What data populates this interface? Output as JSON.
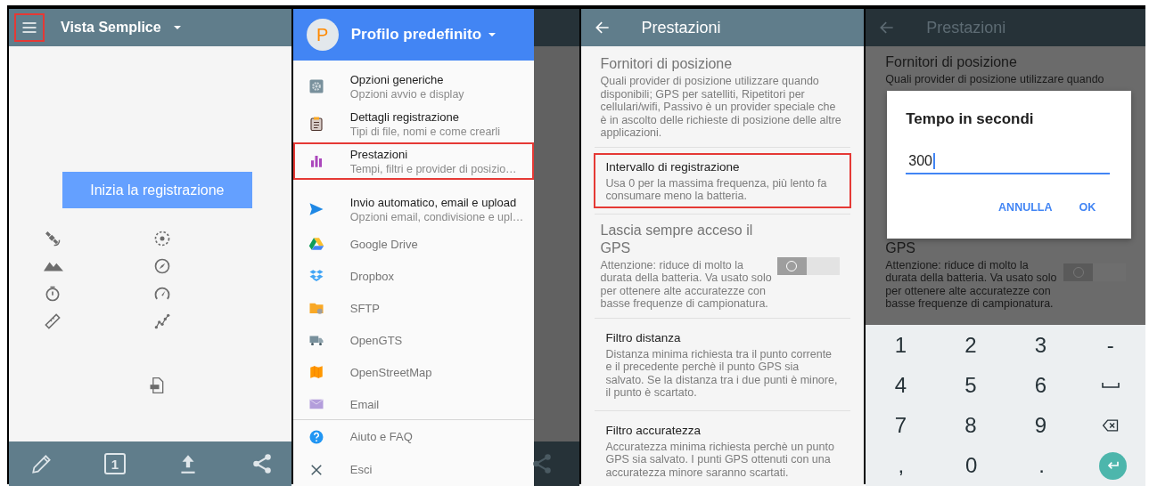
{
  "main_screen": {
    "title": "Vista Semplice",
    "menu_highlighted": true,
    "start_button": "Inizia la registrazione",
    "counter": "1"
  },
  "drawer": {
    "avatar_letter": "P",
    "profile": "Profilo predefinito",
    "items": [
      {
        "kind": "main",
        "title": "Opzioni generiche",
        "subtitle": "Opzioni avvio e display",
        "highlighted": false
      },
      {
        "kind": "main",
        "title": "Dettagli registrazione",
        "subtitle": "Tipi di file, nomi e come crearli",
        "highlighted": false
      },
      {
        "kind": "main",
        "title": "Prestazioni",
        "subtitle": "Tempi, filtri e provider di posizio…",
        "highlighted": true
      },
      {
        "kind": "main",
        "title": "Invio automatico, email e upload",
        "subtitle": "Opzioni email, condivisione e upl…",
        "highlighted": false
      },
      {
        "kind": "sub",
        "title": "Google Drive",
        "highlighted": false
      },
      {
        "kind": "sub",
        "title": "Dropbox",
        "highlighted": false
      },
      {
        "kind": "sub",
        "title": "SFTP",
        "highlighted": false
      },
      {
        "kind": "sub",
        "title": "OpenGTS",
        "highlighted": false
      },
      {
        "kind": "sub",
        "title": "OpenStreetMap",
        "highlighted": false
      },
      {
        "kind": "sub",
        "title": "Email",
        "highlighted": false
      }
    ],
    "footer": [
      {
        "title": "Aiuto e FAQ"
      },
      {
        "title": "Esci"
      }
    ]
  },
  "settings_screen": {
    "title": "Prestazioni",
    "items": [
      {
        "kind": "plain",
        "title": "Fornitori di posizione",
        "description": "Quali provider di posizione utilizzare quando disponibili; GPS per satelliti, Ripetitori per cellulari/wifi, Passivo è un provider speciale che è in ascolto delle richieste di posizione delle altre applicazioni.",
        "disabled": true,
        "highlighted": false
      },
      {
        "kind": "plain",
        "title": "Intervallo di registrazione",
        "description": "Usa 0 per la massima frequenza, più lento fa consumare meno la batteria.",
        "disabled": false,
        "highlighted": true
      },
      {
        "kind": "switch",
        "title": "Lascia sempre acceso il GPS",
        "description": "Attenzione: riduce di molto la durata della batteria. Va usato solo per ottenere alte accuratezze con basse frequenze di campionatura.",
        "disabled": true,
        "highlighted": false,
        "on": false
      },
      {
        "kind": "plain",
        "title": "Filtro distanza",
        "description": "Distanza minima richiesta tra il punto corrente e il precedente perchè il punto GPS sia salvato. Se la distanza tra i due punti è minore, il punto è scartato.",
        "disabled": false,
        "highlighted": false
      },
      {
        "kind": "plain",
        "title": "Filtro accuratezza",
        "description": "Accuratezza minima richiesta perchè un punto GPS sia salvato. I punti GPS ottenuti con una accuratezza minore saranno scartati.",
        "disabled": false,
        "highlighted": false
      }
    ]
  },
  "dialog_screen": {
    "title": "Prestazioni",
    "background": [
      {
        "kind": "plain",
        "title": "Fornitori di posizione",
        "description": "Quali provider di posizione utilizzare quando"
      },
      {
        "kind": "switch",
        "title": "GPS",
        "description": "Attenzione: riduce di molto la durata della batteria. Va usato solo per ottenere alte accuratezze con basse frequenze di campionatura.",
        "on": false
      }
    ],
    "dialog": {
      "title": "Tempo in secondi",
      "value": "300",
      "buttons": [
        "ANNULLA",
        "OK"
      ]
    },
    "keyboard": [
      [
        {
          "kind": "char",
          "label": "1"
        },
        {
          "kind": "char",
          "label": "2"
        },
        {
          "kind": "char",
          "label": "3"
        },
        {
          "kind": "char",
          "label": "-"
        }
      ],
      [
        {
          "kind": "char",
          "label": "4"
        },
        {
          "kind": "char",
          "label": "5"
        },
        {
          "kind": "char",
          "label": "6"
        },
        {
          "kind": "space"
        }
      ],
      [
        {
          "kind": "char",
          "label": "7"
        },
        {
          "kind": "char",
          "label": "8"
        },
        {
          "kind": "char",
          "label": "9"
        },
        {
          "kind": "backspace"
        }
      ],
      [
        {
          "kind": "char",
          "label": ","
        },
        {
          "kind": "char",
          "label": "0"
        },
        {
          "kind": "char",
          "label": "."
        },
        {
          "kind": "enter"
        }
      ]
    ]
  }
}
